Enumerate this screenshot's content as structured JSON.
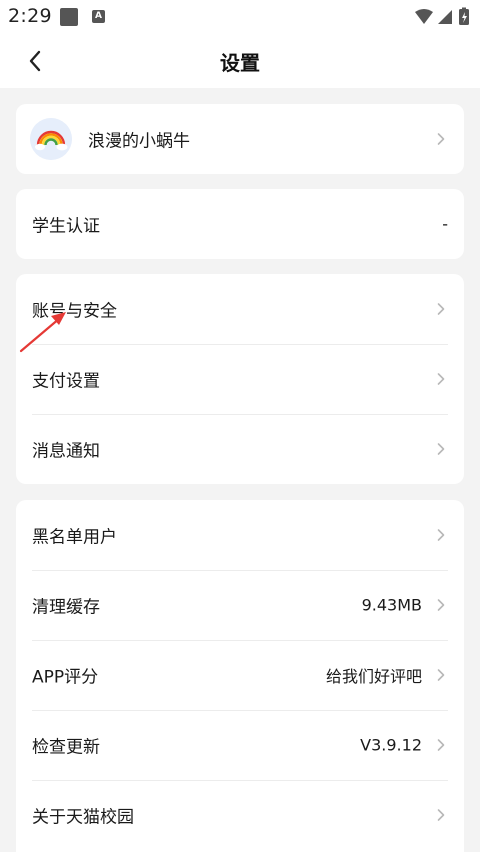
{
  "status_bar": {
    "time": "2:29",
    "a_label": "A"
  },
  "header": {
    "title": "设置"
  },
  "profile": {
    "name": "浪漫的小蜗牛"
  },
  "student": {
    "label": "学生认证",
    "value": "-"
  },
  "account_group": [
    {
      "label": "账号与安全"
    },
    {
      "label": "支付设置"
    },
    {
      "label": "消息通知"
    }
  ],
  "misc_group": [
    {
      "label": "黑名单用户",
      "value": ""
    },
    {
      "label": "清理缓存",
      "value": "9.43MB"
    },
    {
      "label": "APP评分",
      "value": "给我们好评吧"
    },
    {
      "label": "检查更新",
      "value": "V3.9.12"
    },
    {
      "label": "关于天猫校园",
      "value": ""
    }
  ],
  "colors": {
    "annotation_arrow": "#e53935",
    "chevron": "#b8b8b8",
    "background": "#f3f3f3"
  }
}
